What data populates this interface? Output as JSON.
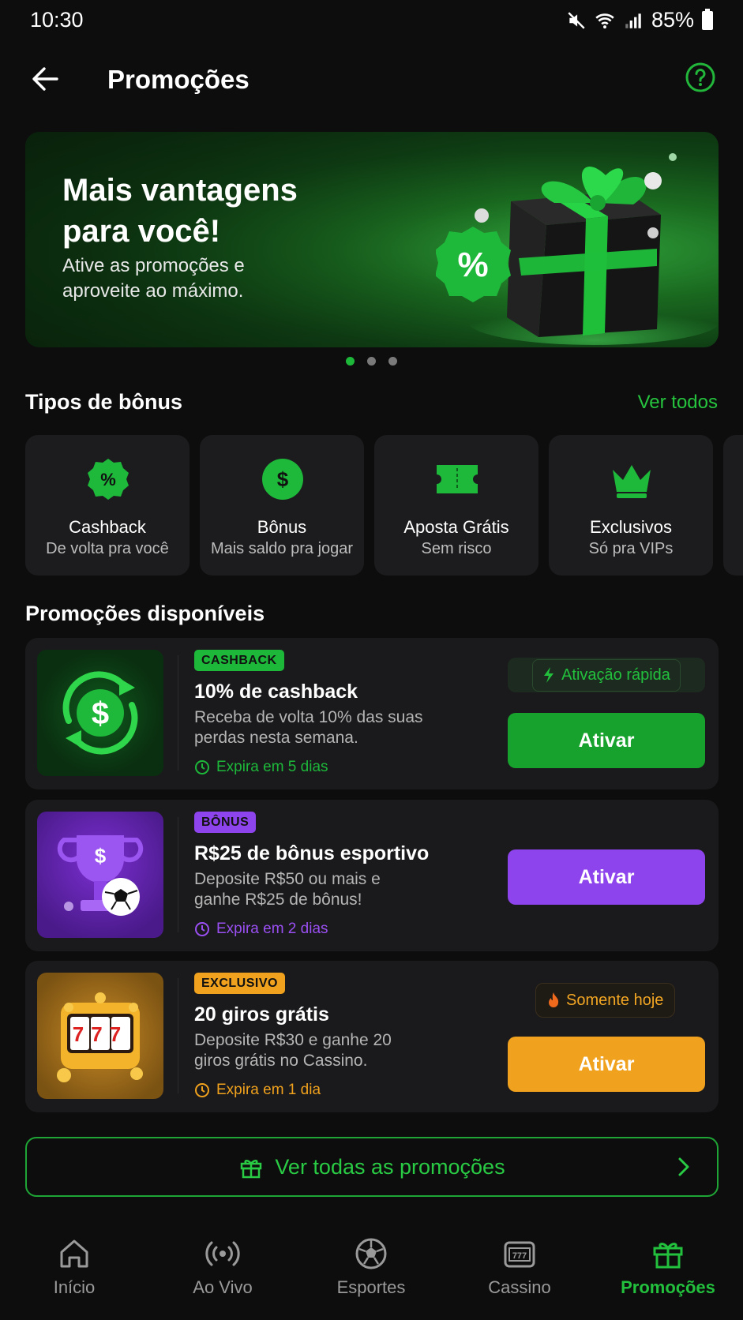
{
  "status_bar": {
    "time": "10:30",
    "battery": "85%"
  },
  "header": {
    "title": "Promoções"
  },
  "banner": {
    "title": "Mais vantagens para você!",
    "subtitle": "Ative as promoções e aproveite ao máximo.",
    "badge_symbol": "%",
    "slides": 3,
    "active_slide": 1
  },
  "bonus_types": {
    "title": "Tipos de bônus",
    "see_all": "Ver todos",
    "items": [
      {
        "name": "Cashback",
        "sub": "De volta pra você",
        "icon": "percent-badge-icon"
      },
      {
        "name": "Bônus",
        "sub": "Mais saldo pra jogar",
        "icon": "dollar-coin-icon"
      },
      {
        "name": "Aposta Grátis",
        "sub": "Sem risco",
        "icon": "ticket-icon"
      },
      {
        "name": "Exclusivos",
        "sub": "Só pra VIPs",
        "icon": "crown-icon"
      }
    ]
  },
  "promotions": {
    "title": "Promoções disponíveis",
    "items": [
      {
        "tag": "CASHBACK",
        "title": "10% de cashback",
        "desc": "Receba de volta 10% das suas perdas nesta semana.",
        "expires": "Expira em 5 dias",
        "pill": "Ativação rápida",
        "button": "Ativar",
        "accent": "#1db83a"
      },
      {
        "tag": "BÔNUS",
        "title": "R$25 de bônus esportivo",
        "desc": "Deposite R$50 ou mais e ganhe R$25 de bônus!",
        "expires": "Expira em 2 dias",
        "button": "Ativar",
        "accent": "#8e44ec"
      },
      {
        "tag": "EXCLUSIVO",
        "title": "20 giros grátis",
        "desc": "Deposite R$30 e ganhe 20 giros grátis no Cassino.",
        "expires": "Expira em 1 dia",
        "pill": "Somente hoje",
        "button": "Ativar",
        "accent": "#f0a11d"
      }
    ],
    "see_all": "Ver todas as promoções"
  },
  "thumbs": {
    "slot_digits": "777"
  },
  "nav": {
    "items": [
      {
        "label": "Início",
        "icon": "home-icon"
      },
      {
        "label": "Ao Vivo",
        "icon": "live-broadcast-icon"
      },
      {
        "label": "Esportes",
        "icon": "soccer-ball-icon"
      },
      {
        "label": "Cassino",
        "icon": "slot-machine-icon"
      },
      {
        "label": "Promoções",
        "icon": "gift-icon",
        "active": true
      }
    ]
  }
}
